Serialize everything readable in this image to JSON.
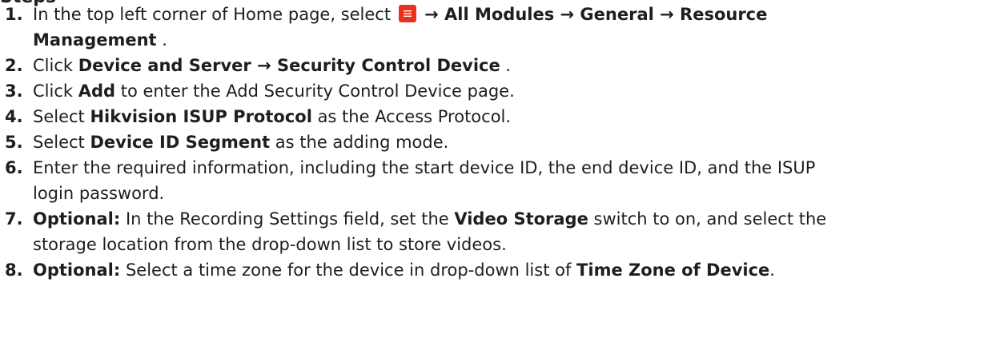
{
  "heading_fragment": "Steps",
  "steps": [
    {
      "num": "1.",
      "line1": {
        "t1": "In the top left corner of Home page, select ",
        "b1": " → All Modules → General → Resource"
      },
      "line2": {
        "b1": "Management",
        "t1": " ."
      }
    },
    {
      "num": "2.",
      "t1": "Click ",
      "b1": "Device and Server → Security Control Device",
      "t2": " ."
    },
    {
      "num": "3.",
      "t1": "Click ",
      "b1": "Add",
      "t2": " to enter the Add Security Control Device page."
    },
    {
      "num": "4.",
      "t1": "Select ",
      "b1": "Hikvision ISUP Protocol",
      "t2": " as the Access Protocol."
    },
    {
      "num": "5.",
      "t1": "Select ",
      "b1": "Device ID Segment",
      "t2": " as the adding mode."
    },
    {
      "num": "6.",
      "line1": "Enter the required information, including the start device ID, the end device ID, and the ISUP",
      "line2": "login password."
    },
    {
      "num": "7.",
      "line1": {
        "b1": "Optional:",
        "t1": " In the Recording Settings field, set the ",
        "b2": "Video Storage",
        "t2": " switch to on, and select the"
      },
      "line2": "storage location from the drop-down list to store videos."
    },
    {
      "num": "8.",
      "b1": "Optional:",
      "t1": " Select a time zone for the device in drop-down list of ",
      "b2": "Time Zone of Device",
      "t2": "."
    }
  ],
  "icons": {
    "menu": "hamburger-menu-icon",
    "menu_color": "#e8321e"
  }
}
